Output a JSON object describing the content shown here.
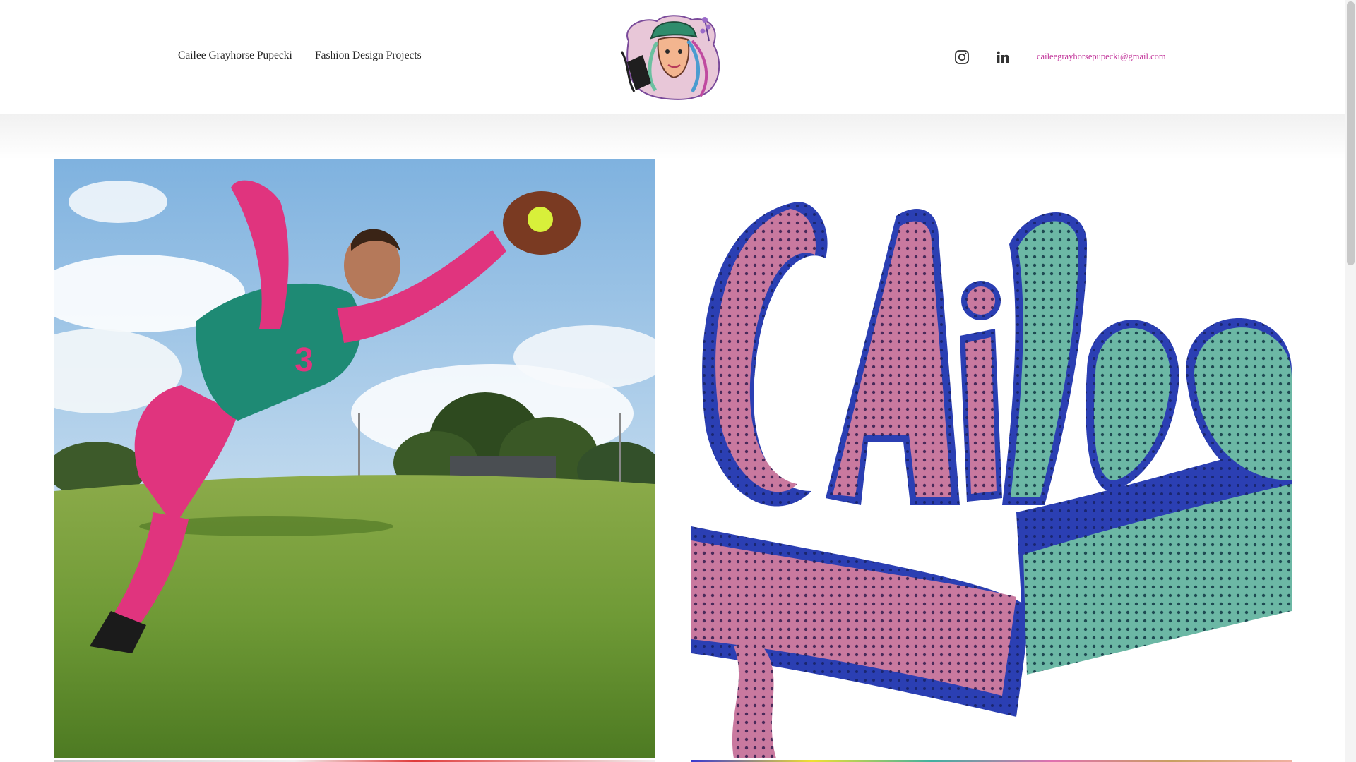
{
  "header": {
    "nav": [
      {
        "label": "Cailee Grayhorse Pupecki",
        "active": false
      },
      {
        "label": "Fashion Design Projects",
        "active": true
      }
    ],
    "logo_icon": "portrait-logo-icon",
    "social": [
      {
        "icon": "instagram-icon"
      },
      {
        "icon": "linkedin-icon"
      }
    ],
    "email": "caileegrayhorsepupecki@gmail.com"
  },
  "gallery": {
    "tiles": [
      {
        "image": "softball-player-diving-catch-photo"
      },
      {
        "image": "cailee-lettering-mesh-jersey-photo"
      }
    ]
  },
  "colors": {
    "accent_pink": "#c2349a",
    "text": "#222222",
    "lettering_pink": "#c9799f",
    "lettering_teal": "#6cb8a5",
    "lettering_blue": "#2b3fb3"
  }
}
